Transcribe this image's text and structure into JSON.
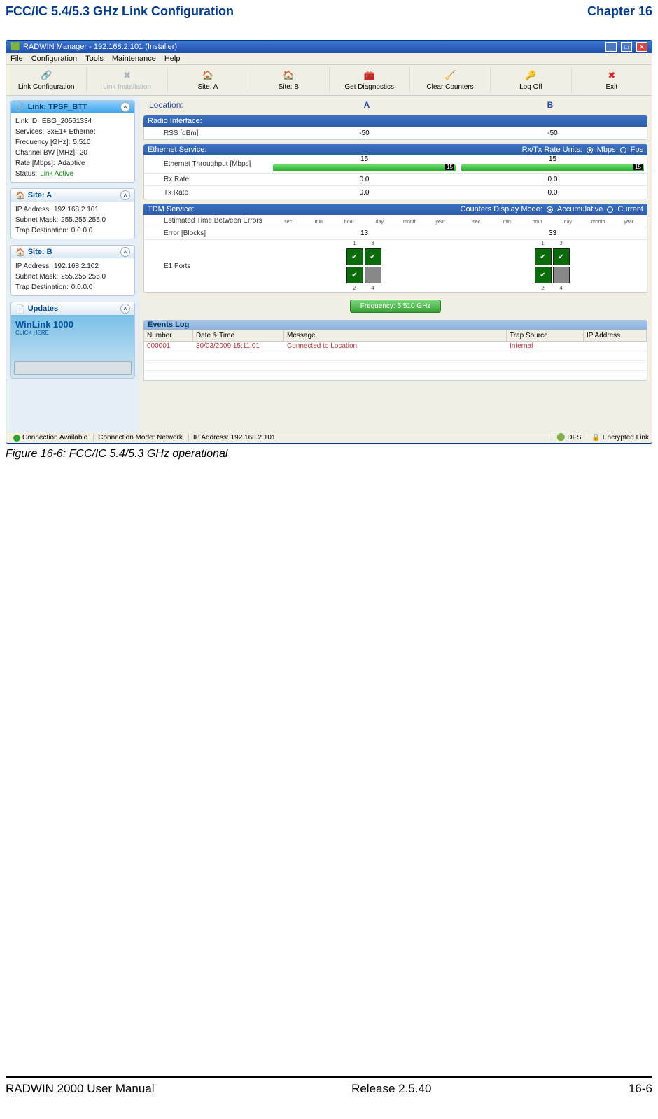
{
  "page": {
    "header_left": "FCC/IC 5.4/5.3 GHz Link Configuration",
    "header_right": "Chapter 16",
    "caption": "Figure 16-6: FCC/IC 5.4/5.3 GHz operational",
    "footer_left": "RADWIN 2000 User Manual",
    "footer_center": "Release  2.5.40",
    "footer_right": "16-6"
  },
  "app": {
    "title": "RADWIN Manager - 192.168.2.101 (Installer)",
    "menu": [
      "File",
      "Configuration",
      "Tools",
      "Maintenance",
      "Help"
    ],
    "toolbar": [
      {
        "label": "Link Configuration",
        "icon": "🔗"
      },
      {
        "label": "Link Installation",
        "icon": "✖"
      },
      {
        "label": "Site: A",
        "icon": "🏠"
      },
      {
        "label": "Site: B",
        "icon": "🏠"
      },
      {
        "label": "Get Diagnostics",
        "icon": "🧰"
      },
      {
        "label": "Clear Counters",
        "icon": "🧹"
      },
      {
        "label": "Log Off",
        "icon": "🔑"
      },
      {
        "label": "Exit",
        "icon": "✖"
      }
    ]
  },
  "sidebar": {
    "link": {
      "title": "Link: TPSF_BTT",
      "rows": [
        [
          "Link ID:",
          "EBG_20561334"
        ],
        [
          "Services:",
          "3xE1+ Ethernet"
        ],
        [
          "Frequency [GHz]:",
          "5.510"
        ],
        [
          "Channel BW [MHz]:",
          "20"
        ],
        [
          "Rate [Mbps]:",
          "Adaptive"
        ],
        [
          "Status:",
          "Link Active"
        ]
      ]
    },
    "siteA": {
      "title": "Site: A",
      "rows": [
        [
          "IP Address:",
          "192.168.2.101"
        ],
        [
          "Subnet Mask:",
          "255.255.255.0"
        ],
        [
          "Trap Destination:",
          "0.0.0.0"
        ]
      ]
    },
    "siteB": {
      "title": "Site: B",
      "rows": [
        [
          "IP Address:",
          "192.168.2.102"
        ],
        [
          "Subnet Mask:",
          "255.255.255.0"
        ],
        [
          "Trap Destination:",
          "0.0.0.0"
        ]
      ]
    },
    "updates": {
      "title": "Updates",
      "promo1": "WinLink 1000",
      "promo2": "CLICK HERE"
    }
  },
  "main": {
    "location_label": "Location:",
    "colA": "A",
    "colB": "B",
    "radio": {
      "header": "Radio Interface:",
      "row_label": "RSS [dBm]",
      "a": "-50",
      "b": "-50"
    },
    "eth": {
      "header": "Ethernet Service:",
      "units_label": "Rx/Tx Rate Units:",
      "unit1": "Mbps",
      "unit2": "Fps",
      "rows": [
        {
          "label": "Ethernet Throughput [Mbps]",
          "a": "15",
          "b": "15",
          "bar": true
        },
        {
          "label": "Rx Rate",
          "a": "0.0",
          "b": "0.0"
        },
        {
          "label": "Tx Rate",
          "a": "0.0",
          "b": "0.0"
        }
      ],
      "bar_max": "15"
    },
    "tdm": {
      "header": "TDM Service:",
      "mode_label": "Counters Display Mode:",
      "mode1": "Accumulative",
      "mode2": "Current",
      "timelabels": [
        "sec",
        "min",
        "hour",
        "day",
        "month",
        "year"
      ],
      "row1": "Estimated Time Between Errors",
      "row2": "Error [Blocks]",
      "err_a": "13",
      "err_b": "33",
      "row3": "E1 Ports"
    },
    "freq": "Frequency: 5.510 GHz",
    "events": {
      "title": "Events Log",
      "cols": [
        "Number",
        "Date & Time",
        "Message",
        "Trap Source",
        "IP Address"
      ],
      "row": {
        "num": "000001",
        "dt": "30/03/2009 15:11:01",
        "msg": "Connected to Location.",
        "ts": "Internal",
        "ip": ""
      }
    }
  },
  "status": {
    "conn": "Connection Available",
    "mode": "Connection Mode: Network",
    "ip": "IP Address: 192.168.2.101",
    "dfs": "DFS",
    "enc": "Encrypted Link"
  }
}
